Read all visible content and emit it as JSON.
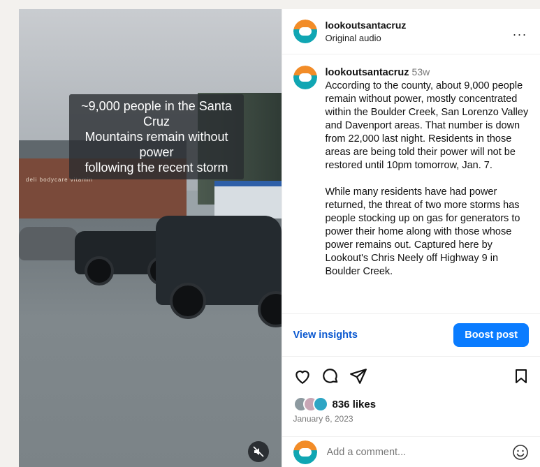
{
  "media": {
    "caption_lines": [
      "~9,000 people in the Santa Cruz",
      "Mountains remain without power",
      "following the recent storm"
    ],
    "store_sign": "deli   bodycare   vitamin"
  },
  "header": {
    "username": "lookoutsantacruz",
    "subtitle": "Original audio",
    "more": "..."
  },
  "comment": {
    "username": "lookoutsantacruz",
    "time": "53w",
    "paragraph1": "According to the county, about 9,000 people remain without power, mostly concentrated within the Boulder Creek, San Lorenzo Valley and Davenport areas. That number is down from 22,000 last night. Residents in those areas are being told their power will not be restored until 10pm tomorrow, Jan. 7.",
    "paragraph2": "While many residents have had power returned, the threat of two more storms has people stocking up on gas for generators to power their home along with those whose power remains out. Captured here by Lookout's Chris Neely off Highway 9 in Boulder Creek."
  },
  "actions": {
    "view_insights": "View insights",
    "boost_post": "Boost post"
  },
  "engagement": {
    "likes": "836 likes",
    "date": "January 6, 2023"
  },
  "add_comment": {
    "placeholder": "Add a comment..."
  },
  "colors": {
    "accent": "#0a7cff",
    "link": "#0a58d0",
    "logo_orange": "#f28c28",
    "logo_teal": "#10a6b3"
  }
}
